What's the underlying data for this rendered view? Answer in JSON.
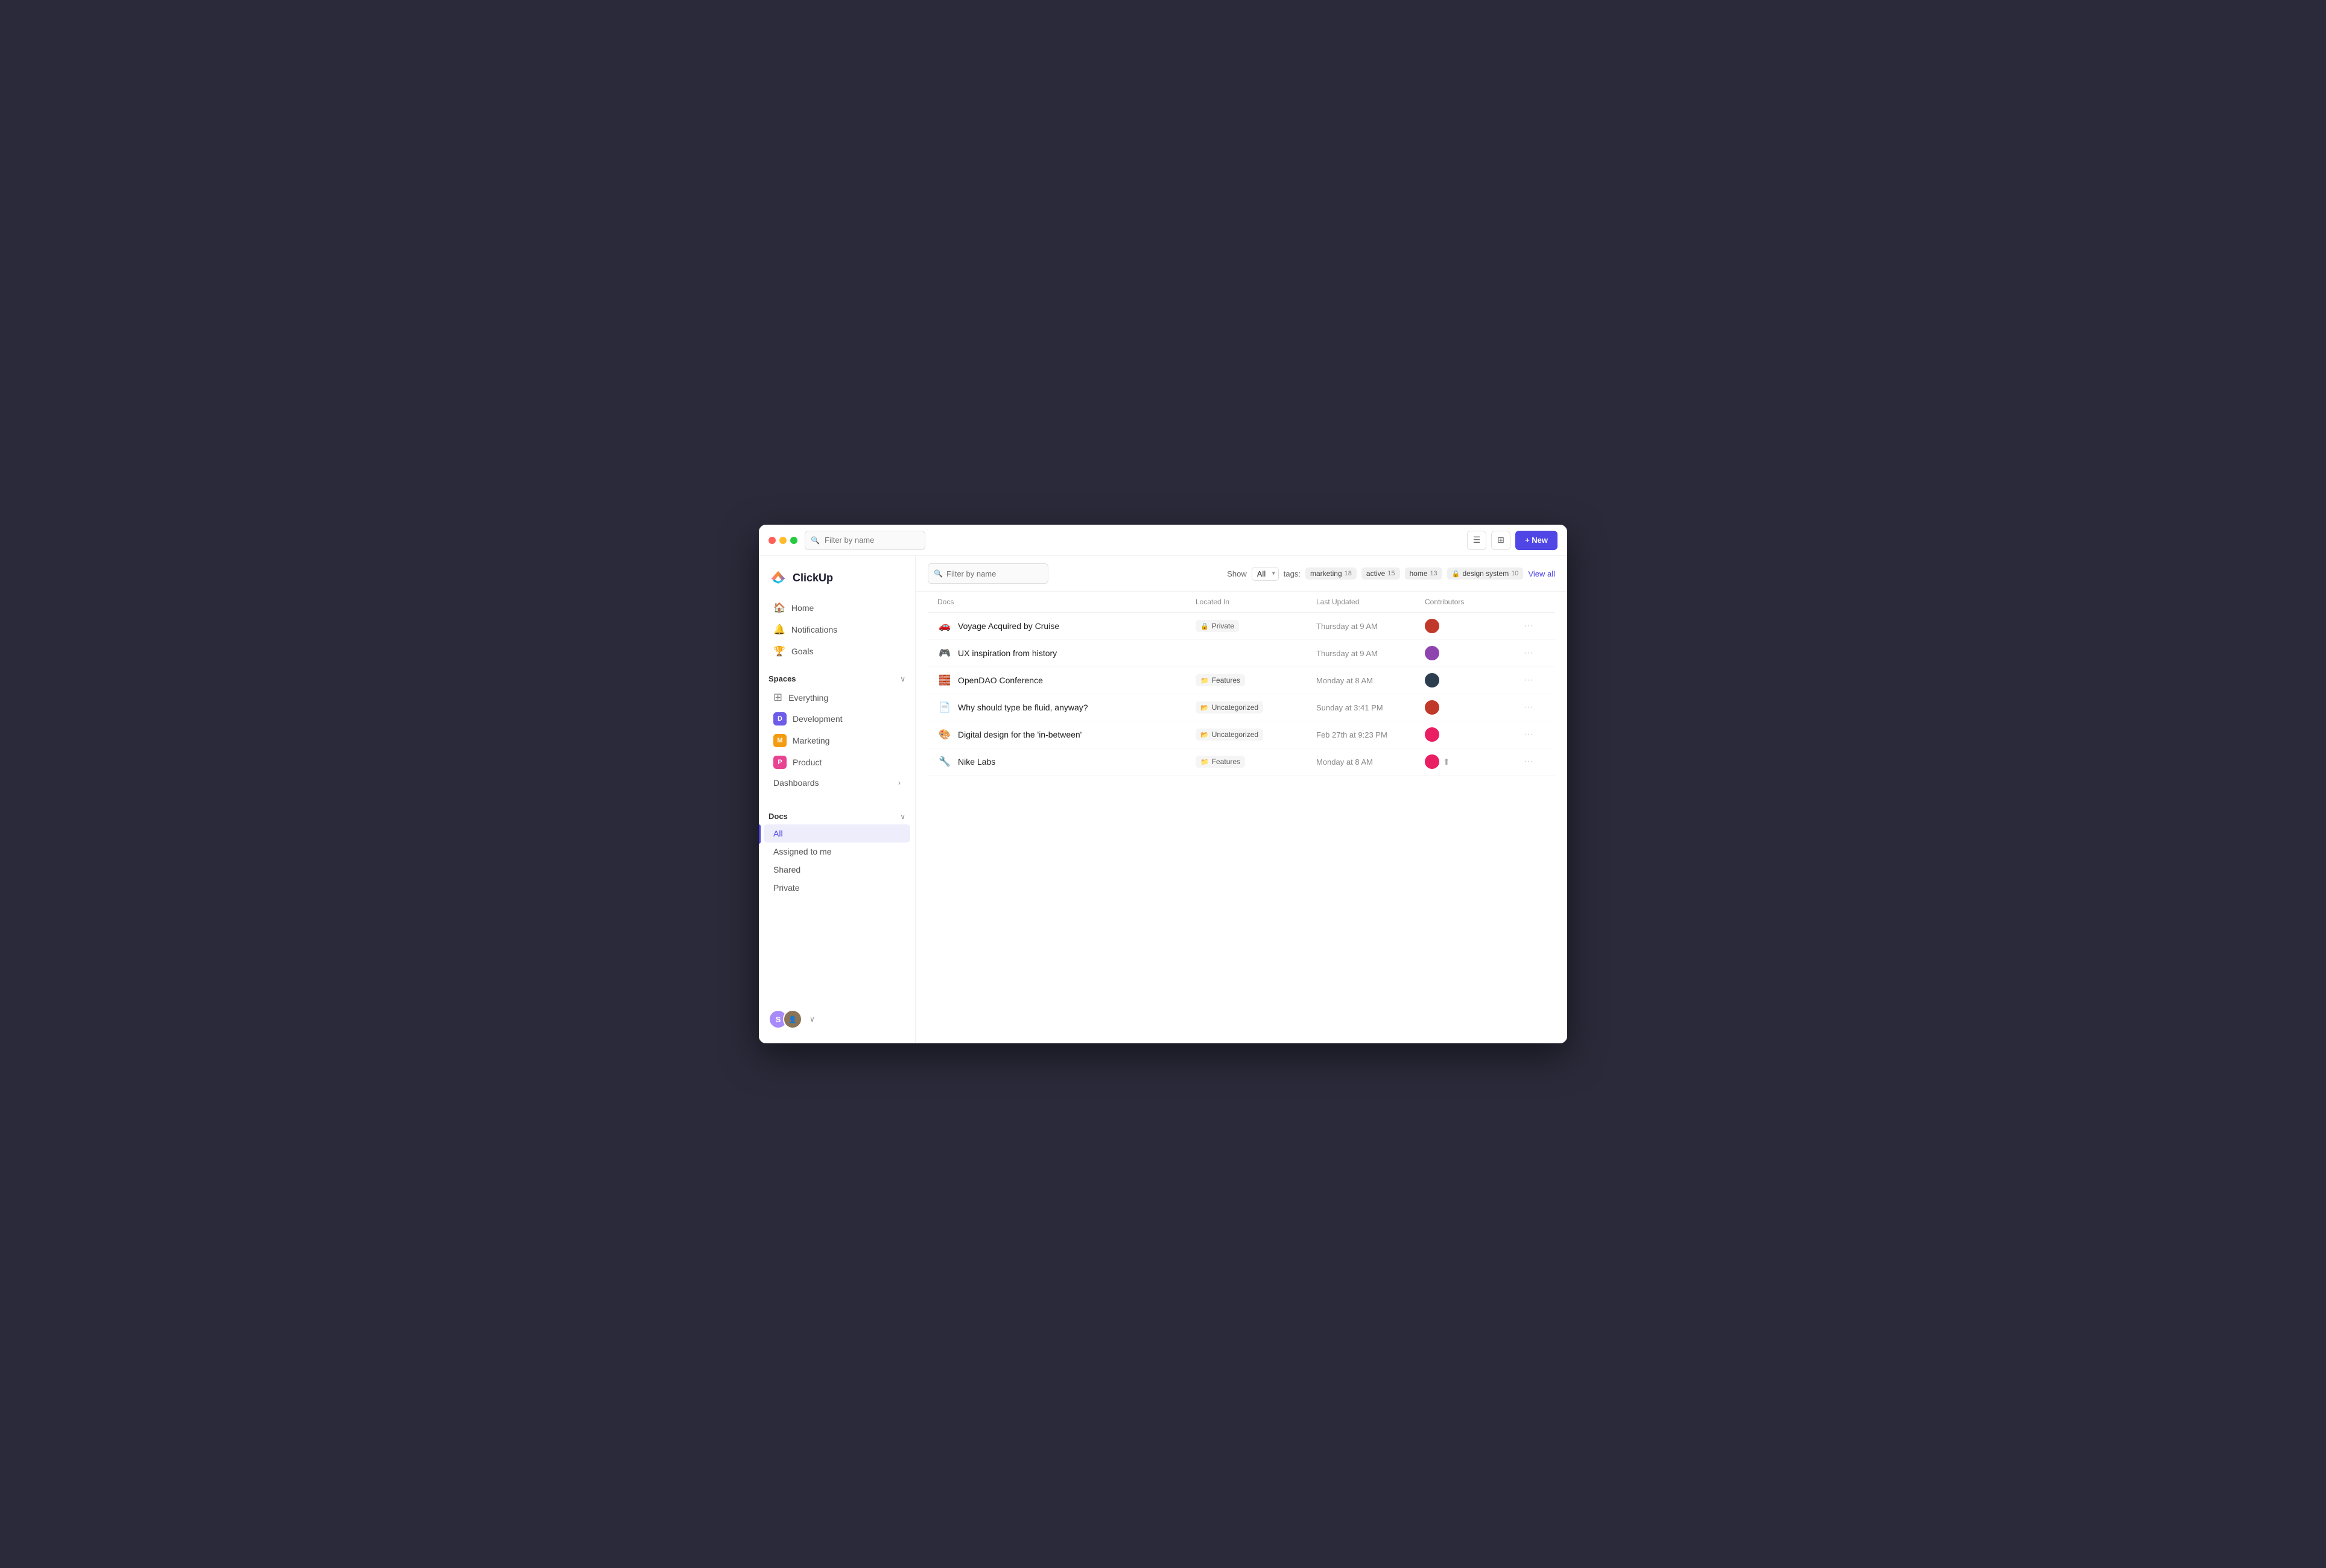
{
  "app": {
    "name": "ClickUp"
  },
  "titlebar": {
    "search_placeholder": "Filter by name",
    "new_button": "+ New"
  },
  "sidebar": {
    "nav_items": [
      {
        "id": "home",
        "label": "Home",
        "icon": "🏠"
      },
      {
        "id": "notifications",
        "label": "Notifications",
        "icon": "🔔"
      },
      {
        "id": "goals",
        "label": "Goals",
        "icon": "🏆"
      }
    ],
    "spaces_section": "Spaces",
    "spaces": [
      {
        "id": "everything",
        "label": "Everything",
        "type": "grid"
      },
      {
        "id": "development",
        "label": "Development",
        "letter": "D",
        "color": "#6c5ce7"
      },
      {
        "id": "marketing",
        "label": "Marketing",
        "letter": "M",
        "color": "#f39c12"
      },
      {
        "id": "product",
        "label": "Product",
        "letter": "P",
        "color": "#e84393"
      }
    ],
    "dashboards_label": "Dashboards",
    "docs_section": "Docs",
    "docs_items": [
      {
        "id": "all",
        "label": "All",
        "active": true
      },
      {
        "id": "assigned",
        "label": "Assigned to me",
        "active": false
      },
      {
        "id": "shared",
        "label": "Shared",
        "active": false
      },
      {
        "id": "private",
        "label": "Private",
        "active": false
      }
    ]
  },
  "toolbar": {
    "filter_placeholder": "Filter by name",
    "show_label": "Show",
    "show_value": "All",
    "tags_label": "tags:",
    "tags": [
      {
        "id": "marketing",
        "label": "marketing",
        "count": "18"
      },
      {
        "id": "active",
        "label": "active",
        "count": "15"
      },
      {
        "id": "home",
        "label": "home",
        "count": "13"
      },
      {
        "id": "design-system",
        "label": "design system",
        "count": "10",
        "locked": true
      }
    ],
    "view_all": "View all"
  },
  "table": {
    "headers": {
      "docs": "Docs",
      "located_in": "Located In",
      "last_updated": "Last Updated",
      "contributors": "Contributors"
    },
    "rows": [
      {
        "id": 1,
        "icon": "🚗",
        "name": "Voyage Acquired by Cruise",
        "location": "Private",
        "location_type": "private",
        "last_updated": "Thursday at 9 AM",
        "contributor_color": "#c0392b"
      },
      {
        "id": 2,
        "icon": "🎮",
        "name": "UX inspiration from history",
        "location": "",
        "location_type": "none",
        "last_updated": "Thursday at 9 AM",
        "contributor_color": "#8e44ad"
      },
      {
        "id": 3,
        "icon": "🧱",
        "name": "OpenDAO Conference",
        "location": "Features",
        "location_type": "folder",
        "last_updated": "Monday at 8 AM",
        "contributor_color": "#2c3e50"
      },
      {
        "id": 4,
        "icon": "📄",
        "name": "Why should type be fluid, anyway?",
        "location": "Uncategorized",
        "location_type": "folder",
        "last_updated": "Sunday at 3:41 PM",
        "contributor_color": "#c0392b"
      },
      {
        "id": 5,
        "icon": "🎨",
        "name": "Digital design for the 'in-between'",
        "location": "Uncategorized",
        "location_type": "folder",
        "last_updated": "Feb 27th at 9:23 PM",
        "contributor_color": "#e91e63"
      },
      {
        "id": 6,
        "icon": "🔧",
        "name": "Nike Labs",
        "location": "Features",
        "location_type": "folder",
        "last_updated": "Monday at 8 AM",
        "contributor_color": "#e91e63",
        "has_upload": true
      }
    ]
  }
}
